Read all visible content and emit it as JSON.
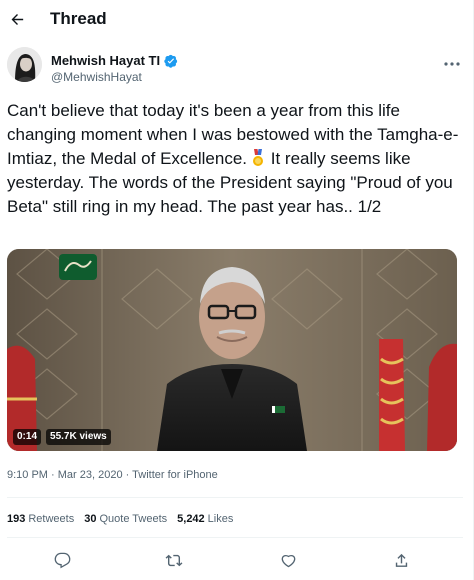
{
  "header": {
    "title": "Thread",
    "back_icon": "arrow-left-icon"
  },
  "author": {
    "name": "Mehwish Hayat TI",
    "handle": "@MehwishHayat",
    "verified_color": "#1d9bf0"
  },
  "tweet": {
    "text_part1": "Can't believe that today it's been a year from this life changing moment when I was bestowed with the Tamgha-e-Imtiaz, the Medal of Excellence.",
    "text_part2": " It really seems like yesterday. The words of the President saying \"Proud of you Beta\" still ring in my head. The past year has.. 1/2",
    "emoji": "medal-icon"
  },
  "video": {
    "time": "0:14",
    "views": "55.7K views"
  },
  "meta": {
    "time": "9:10 PM",
    "sep1": " · ",
    "date": "Mar 23, 2020",
    "sep2": " · ",
    "source": "Twitter for iPhone"
  },
  "stats": [
    {
      "count": "193",
      "label": "Retweets"
    },
    {
      "count": "30",
      "label": "Quote Tweets"
    },
    {
      "count": "5,242",
      "label": "Likes"
    }
  ],
  "actions": [
    "reply-icon",
    "retweet-icon",
    "like-icon",
    "share-icon"
  ],
  "colors": {
    "text": "#0f1419",
    "secondary": "#536471",
    "accent": "#1d9bf0",
    "border": "#eff3f4"
  }
}
